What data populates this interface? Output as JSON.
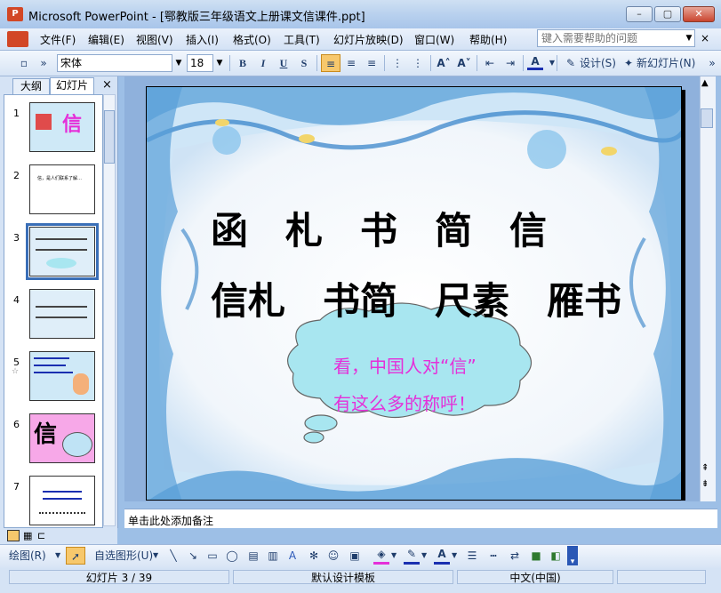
{
  "window": {
    "title": "Microsoft PowerPoint - [鄂教版三年级语文上册课文信课件.ppt]",
    "app_icon_text": "P",
    "controls": [
      "–",
      "▢",
      "✕"
    ]
  },
  "menu": {
    "items": [
      "文件(F)",
      "编辑(E)",
      "视图(V)",
      "插入(I)",
      "格式(O)",
      "工具(T)",
      "幻灯片放映(D)",
      "窗口(W)",
      "帮助(H)"
    ],
    "help_placeholder": "键入需要帮助的问题",
    "close_glyph": "×"
  },
  "format_toolbar": {
    "font": "宋体",
    "size": "18",
    "bold": "B",
    "italic": "I",
    "underline": "U",
    "shadow": "S",
    "design_label": "设计(S)",
    "new_slide_label": "新幻灯片(N)"
  },
  "left_pane": {
    "tabs": [
      "大纲",
      "幻灯片"
    ],
    "close_glyph": "×",
    "thumbnails": [
      {
        "num": "1",
        "text": "信"
      },
      {
        "num": "2",
        "text": "信，是人们联系了解…"
      },
      {
        "num": "3",
        "text": ""
      },
      {
        "num": "4",
        "text": ""
      },
      {
        "num": "5",
        "text": ""
      },
      {
        "num": "6",
        "text": "信"
      },
      {
        "num": "7",
        "text": ""
      }
    ],
    "selected_index": 3
  },
  "slide": {
    "line1": "函　札　书　简　信",
    "line2": "信札　书简　尺素　雁书",
    "bubble_line1": "看，中国人对“信”",
    "bubble_line2": "有这么多的称呼！"
  },
  "notes": {
    "placeholder": "单击此处添加备注"
  },
  "draw_toolbar": {
    "draw_label": "绘图(R)",
    "autoshapes_label": "自选图形(U)"
  },
  "status": {
    "slide_counter": "幻灯片 3 / 39",
    "template": "默认设计模板",
    "language": "中文(中国)"
  },
  "colors": {
    "accent": "#3a6fb7",
    "bubble_text": "#e52fd9",
    "bubble_fill": "#a8e6f0"
  }
}
